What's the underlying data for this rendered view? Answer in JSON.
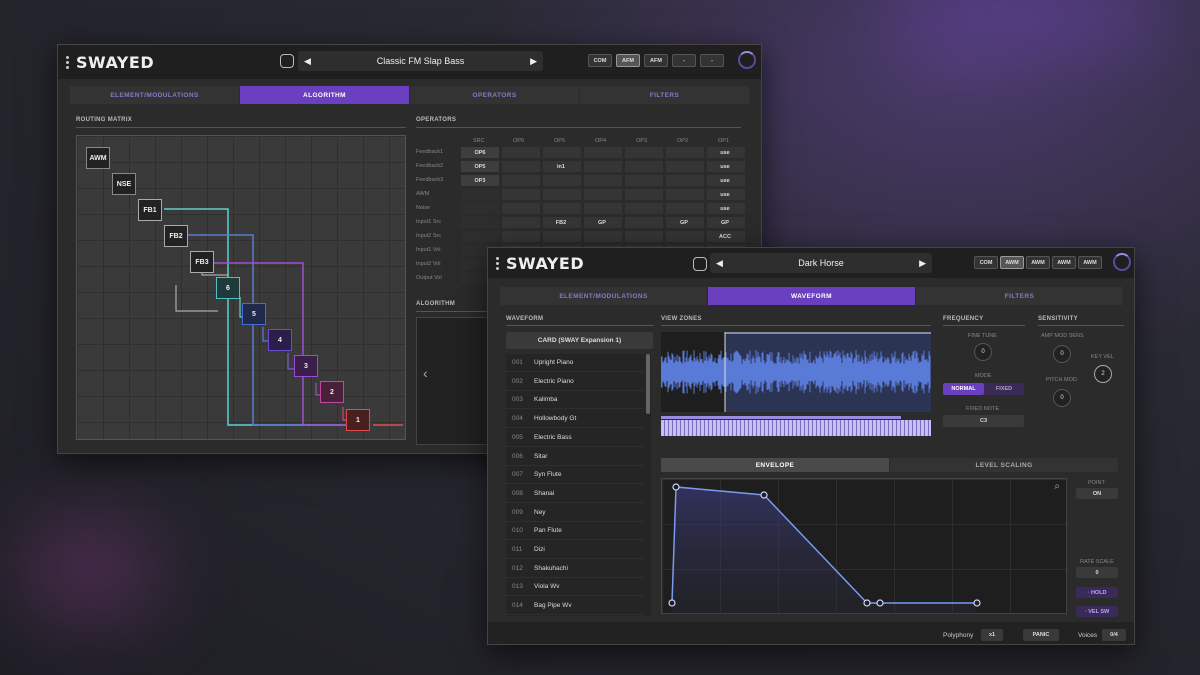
{
  "app_name": "SWAYED",
  "win1": {
    "preset": "Classic FM Slap Bass",
    "modes": [
      "COM",
      "AFM",
      "AFM",
      "-",
      "-"
    ],
    "tabs": [
      "ELEMENT/MODULATIONS",
      "ALGORITHM",
      "OPERATORS",
      "FILTERS"
    ],
    "routing_title": "ROUTING MATRIX",
    "operators_title": "OPERATORS",
    "algorithm_title": "ALGORITHM",
    "nodes": [
      "AWM",
      "NSE",
      "FB1",
      "FB2",
      "FB3",
      "6",
      "5",
      "4",
      "3",
      "2",
      "1"
    ],
    "op_headers": [
      "SRC",
      "OP6",
      "OP5",
      "OP4",
      "OP3",
      "OP2",
      "OP1"
    ],
    "op_rows": [
      "Feedback1",
      "Feedback2",
      "Feedback3",
      "AWM",
      "Noise",
      "Input1 Src",
      "Input2 Src",
      "Input1 Vol",
      "Input2 Vol",
      "Output Vol"
    ],
    "op_vals": {
      "src": [
        "OP6",
        "OP5",
        "OP3"
      ],
      "op5_in1": "in1",
      "use": "use",
      "fb2": "FB2",
      "gp": "GP",
      "acc": "ACC"
    }
  },
  "win2": {
    "preset": "Dark Horse",
    "modes": [
      "COM",
      "AWM",
      "AWM",
      "AWM",
      "AWM"
    ],
    "tabs": [
      "ELEMENT/MODULATIONS",
      "WAVEFORM",
      "FILTERS"
    ],
    "waveform_title": "WAVEFORM",
    "card": "CARD (SWAY Expansion 1)",
    "waveforms": [
      {
        "n": "001",
        "name": "Upright Piano"
      },
      {
        "n": "002",
        "name": "Electric Piano"
      },
      {
        "n": "003",
        "name": "Kalimba"
      },
      {
        "n": "004",
        "name": "Hollowbody Gt"
      },
      {
        "n": "005",
        "name": "Electric Bass"
      },
      {
        "n": "006",
        "name": "Sitar"
      },
      {
        "n": "007",
        "name": "Syn Flute"
      },
      {
        "n": "008",
        "name": "Shanai"
      },
      {
        "n": "009",
        "name": "Ney"
      },
      {
        "n": "010",
        "name": "Pan Flute"
      },
      {
        "n": "011",
        "name": "Dizi"
      },
      {
        "n": "012",
        "name": "Shakuhachi"
      },
      {
        "n": "013",
        "name": "Viola Wv"
      },
      {
        "n": "014",
        "name": "Bag Pipe Wv"
      }
    ],
    "view_zones_title": "VIEW ZONES",
    "frequency_title": "FREQUENCY",
    "fine_tune_label": "FINE TUNE",
    "fine_tune_value": "0",
    "mode_label": "MODE",
    "mode_normal": "NORMAL",
    "mode_fixed": "FIXED",
    "fixed_note_label": "FIXED NOTE",
    "fixed_note_value": "C3",
    "sensitivity_title": "SENSITIVITY",
    "amp_mod_sens_label": "AMP MOD SENS",
    "amp_mod_sens_value": "0",
    "key_vel_label": "KEY VEL",
    "key_vel_value": "2",
    "pitch_mod_label": "PITCH MOD",
    "pitch_mod_value": "0",
    "env_tabs": [
      "ENVELOPE",
      "LEVEL SCALING"
    ],
    "point_label": "POINT",
    "point_value": "ON",
    "rate_scale_label": "RATE SCALE",
    "rate_scale_value": "0",
    "hold_label": "HOLD",
    "vel_sw_label": "VEL SW",
    "polyphony_label": "Polyphony",
    "polyphony_value": "x1",
    "panic_label": "PANIC",
    "voices_label": "Voices",
    "voices_value": "0/4"
  }
}
